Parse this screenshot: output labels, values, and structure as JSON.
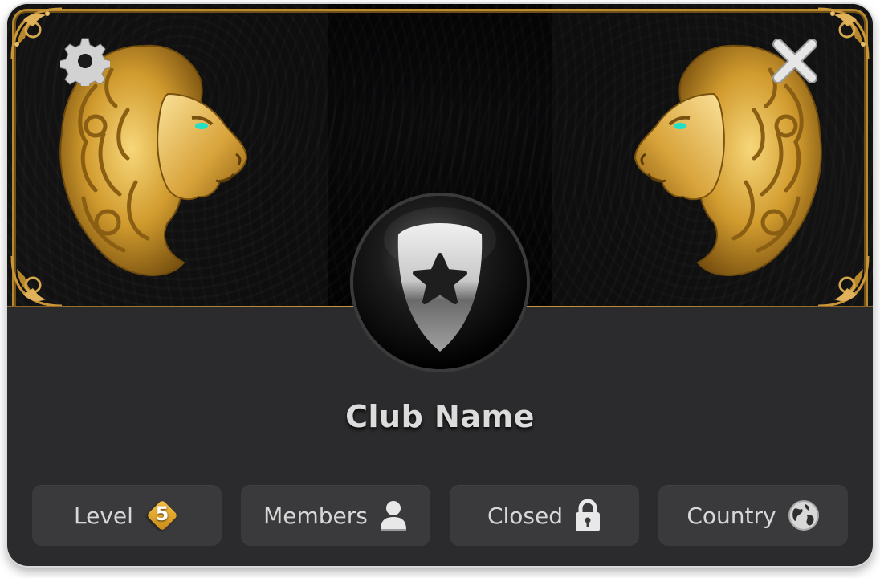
{
  "club": {
    "name": "Club Name"
  },
  "header": {
    "settings_icon": "gear-icon",
    "close_icon": "close-icon",
    "emblem_icon": "shield-star-icon"
  },
  "stats": [
    {
      "label": "Level",
      "icon": "level-badge",
      "value": "5"
    },
    {
      "label": "Members",
      "icon": "person-icon"
    },
    {
      "label": "Closed",
      "icon": "lock-icon"
    },
    {
      "label": "Country",
      "icon": "globe-icon"
    }
  ],
  "colors": {
    "panel": "#2b2b2d",
    "stat_bg": "#3a3a3c",
    "gold": "#d3a34a",
    "text": "#d7d7d7"
  }
}
